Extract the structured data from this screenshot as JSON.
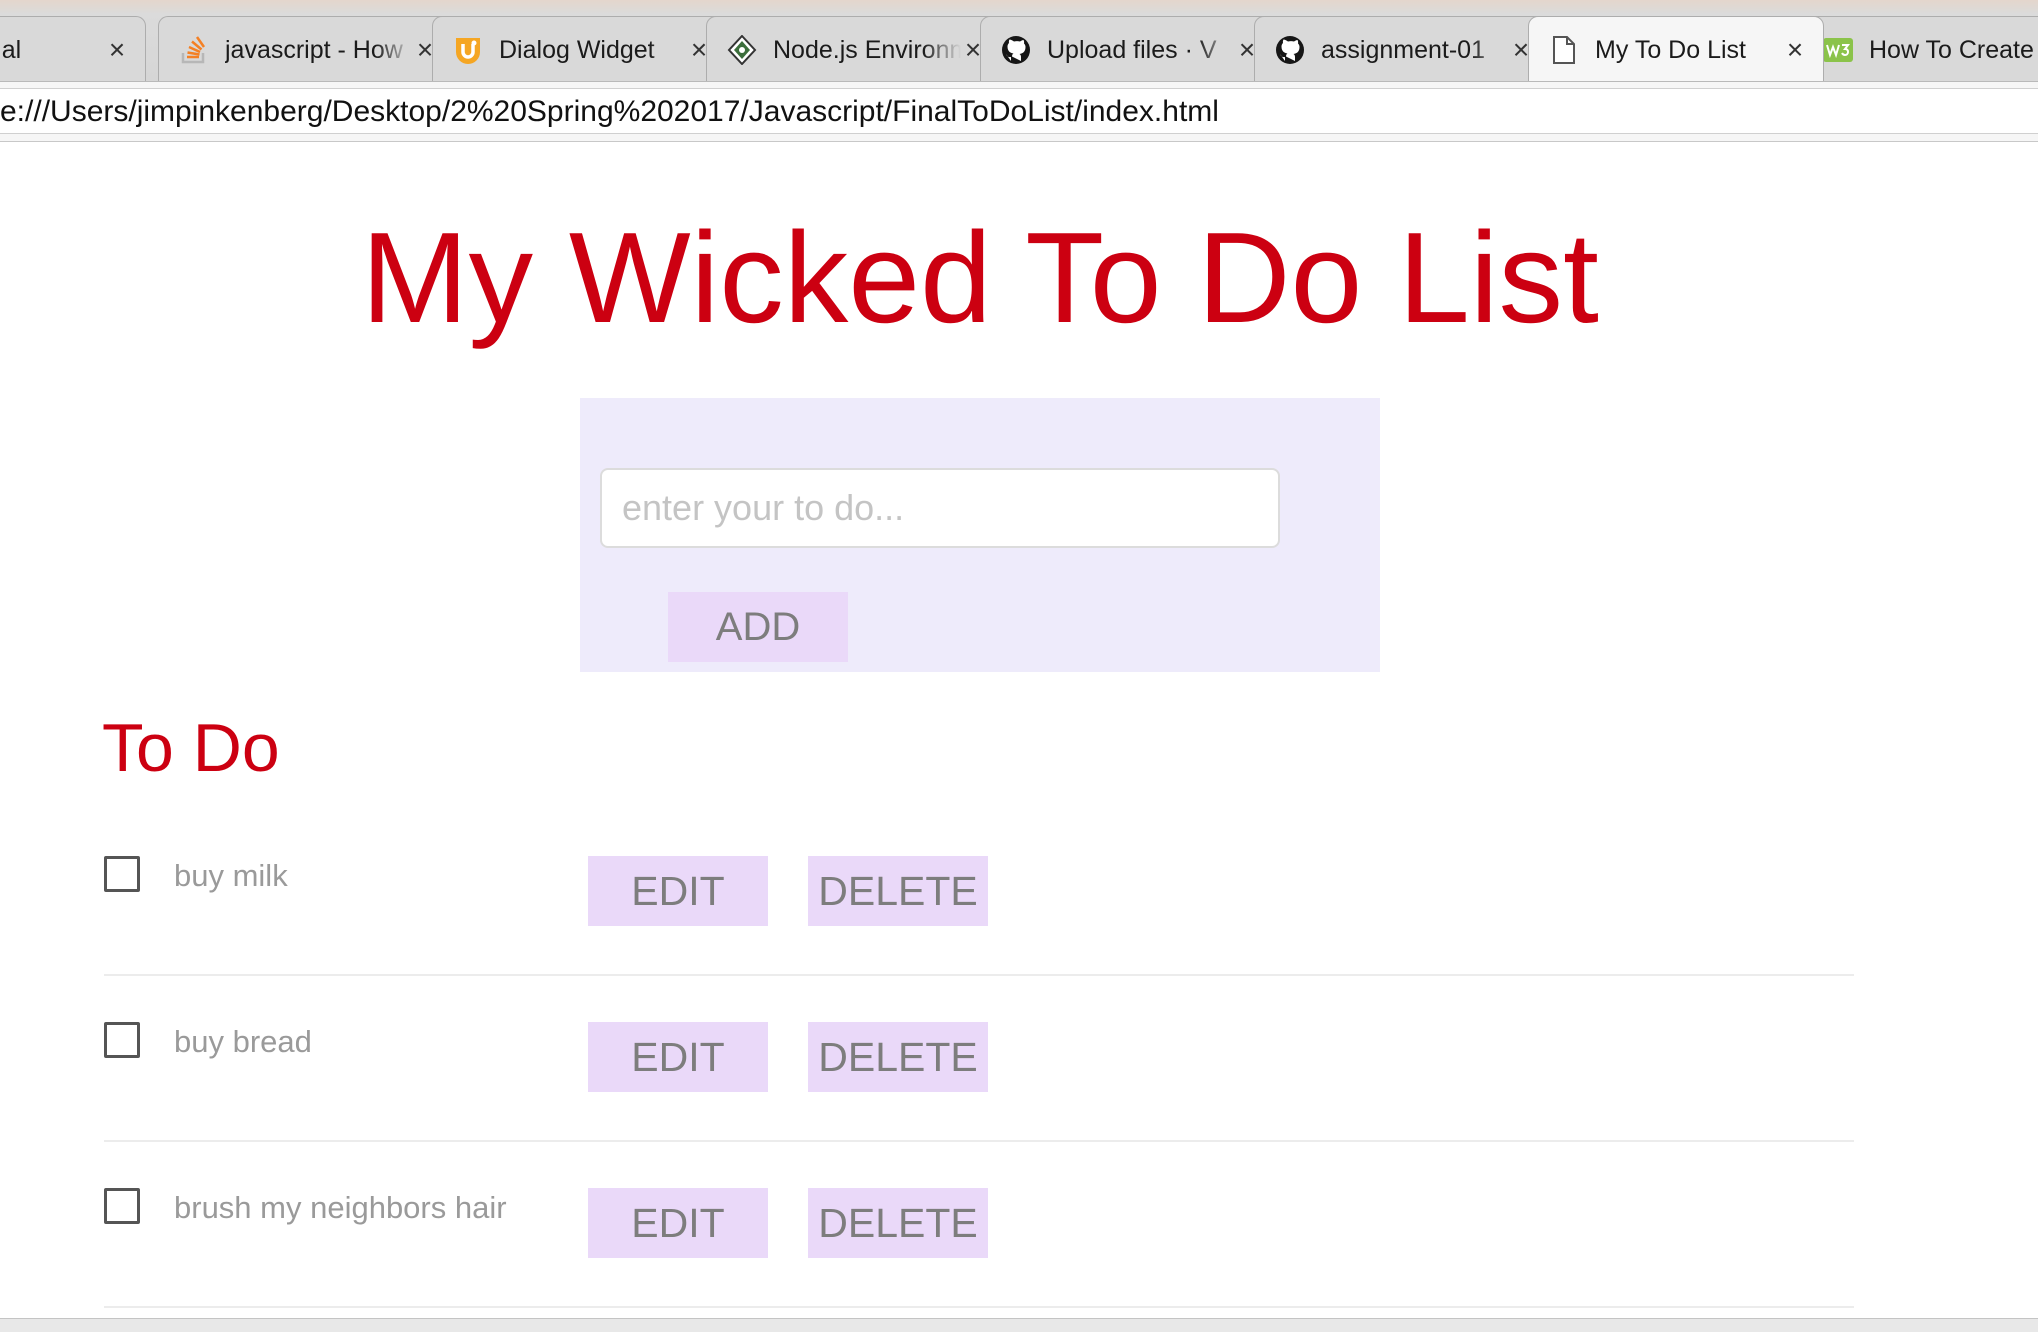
{
  "browser": {
    "tabs": [
      {
        "title": "- Material",
        "icon": "material-icon"
      },
      {
        "title": "javascript - How",
        "icon": "stackoverflow-icon"
      },
      {
        "title": "Dialog Widget",
        "icon": "ui-widget-icon"
      },
      {
        "title": "Node.js Environment",
        "icon": "nodejs-icon"
      },
      {
        "title": "Upload files · V",
        "icon": "github-icon"
      },
      {
        "title": "assignment-01",
        "icon": "github-icon"
      },
      {
        "title": "My To Do List",
        "icon": "page-icon",
        "active": true
      },
      {
        "title": "How To Create",
        "icon": "w3schools-icon"
      }
    ],
    "close_glyph": "×",
    "url": "e:///Users/jimpinkenberg/Desktop/2%20Spring%202017/Javascript/FinalToDoList/index.html"
  },
  "page": {
    "title": "My Wicked To Do List",
    "input_placeholder": "enter your to do...",
    "input_value": "",
    "add_label": "ADD",
    "section_title": "To Do",
    "edit_label": "EDIT",
    "delete_label": "DELETE",
    "todos": [
      {
        "text": "buy milk",
        "done": false
      },
      {
        "text": "buy bread",
        "done": false
      },
      {
        "text": "brush my neighbors hair",
        "done": false
      }
    ]
  },
  "colors": {
    "title_red": "#cc0011",
    "panel_bg": "#eeebfb",
    "button_bg": "#ead9f9",
    "button_text": "#7d7d7d"
  }
}
